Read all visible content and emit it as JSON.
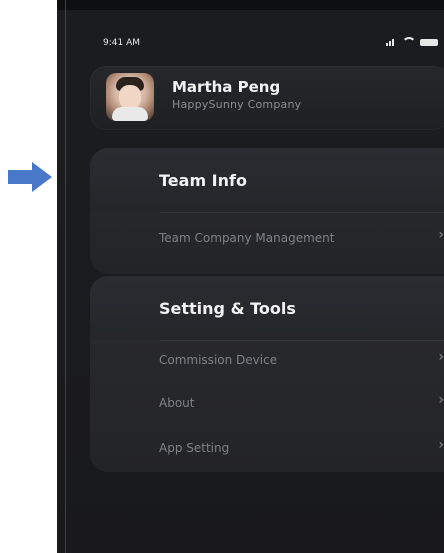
{
  "status": {
    "time": "9:41 AM"
  },
  "profile": {
    "name": "Martha Peng",
    "company": "HappySunny Company"
  },
  "sections": [
    {
      "title": "Team Info",
      "items": [
        {
          "label": "Team Company Management"
        }
      ]
    },
    {
      "title": "Setting & Tools",
      "items": [
        {
          "label": "Commission Device"
        },
        {
          "label": "About"
        },
        {
          "label": "App Setting"
        }
      ]
    }
  ],
  "ui": {
    "chevron": "›"
  },
  "colors": {
    "background": "#1b1c1f",
    "arrow": "#4a78c9"
  },
  "icons": {
    "arrow": "arrow-right-icon",
    "chevron": "chevron-right-icon",
    "signal": "signal-icon",
    "wifi": "wifi-icon",
    "battery": "battery-icon"
  }
}
